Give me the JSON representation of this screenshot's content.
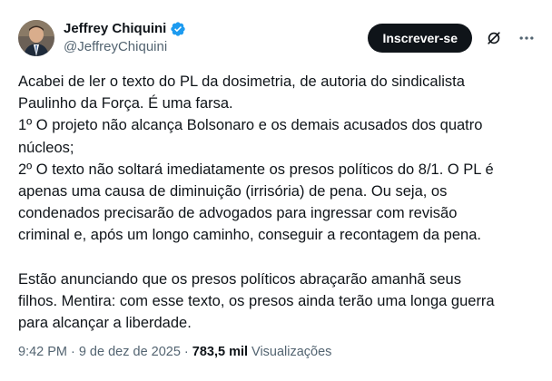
{
  "author": {
    "display_name": "Jeffrey Chiquini",
    "handle": "@JeffreyChiquini",
    "verified_color": "#1d9bf0"
  },
  "actions": {
    "subscribe_label": "Inscrever-se",
    "grok_icon": "grok-icon",
    "more_icon": "more-icon"
  },
  "tweet": {
    "text": "Acabei de ler o texto do PL da dosimetria, de autoria do sindicalista\nPaulinho da Força. É uma farsa.\n1º O projeto não alcança Bolsonaro e os demais acusados dos quatro\nnúcleos;\n2º O texto não soltará imediatamente os presos políticos do 8/1. O PL é\napenas uma causa de diminuição (irrisória) de pena. Ou seja, os\ncondenados precisarão de advogados para ingressar com revisão\ncriminal e, após um longo caminho, conseguir a recontagem da pena.\n\nEstão anunciando que os presos políticos abraçarão amanhã seus\nfilhos. Mentira: com esse texto, os presos ainda terão uma longa guerra\npara alcançar a liberdade."
  },
  "meta": {
    "time": "9:42 PM",
    "sep1": "·",
    "date": "9 de dez de 2025",
    "sep2": "·",
    "views_count": "783,5 mil",
    "views_label": "Visualizações"
  },
  "colors": {
    "text": "#0f1419",
    "secondary": "#536471",
    "button_bg": "#0f1419"
  }
}
